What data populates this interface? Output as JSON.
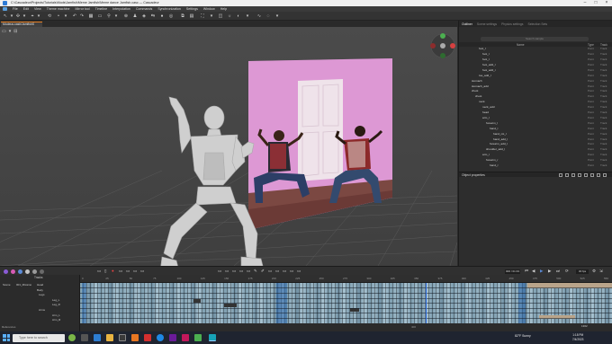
{
  "window": {
    "title": "C:\\Cascadeur\\Projects\\Tutorials\\Mods\\Jamfish\\Meme Jamfish\\Meme dance Jamfish.casc — Cascadeur"
  },
  "menu": [
    "File",
    "Edit",
    "View",
    "Theme machine",
    "Mirror tool",
    "Timeline",
    "Interpolation",
    "Commands",
    "Synchronization",
    "Settings",
    "Window",
    "Help"
  ],
  "document": {
    "tab_label": "Modeus.cash/JamfishS"
  },
  "outliner": {
    "tabs": [
      "Outliner",
      "Scene settings",
      "Physics settings",
      "Selection Sets"
    ],
    "search_placeholder": "Search sample",
    "columns": {
      "name": "Name",
      "type": "Type",
      "track": "Track"
    },
    "rows": [
      {
        "name": "foot_l",
        "type": "Point",
        "track": "Track",
        "indent": 3
      },
      {
        "name": "foot_r",
        "type": "Point",
        "track": "Track",
        "indent": 4
      },
      {
        "name": "foot_r",
        "type": "Point",
        "track": "Track",
        "indent": 4
      },
      {
        "name": "foot_add_l",
        "type": "Point",
        "track": "Track",
        "indent": 4
      },
      {
        "name": "foot_add_r",
        "type": "Point",
        "track": "Track",
        "indent": 4
      },
      {
        "name": "toe_add_l",
        "type": "Point",
        "track": "Track",
        "indent": 3
      },
      {
        "name": "stomach",
        "type": "Point",
        "track": "Track",
        "indent": 1
      },
      {
        "name": "stomach_add",
        "type": "Point",
        "track": "Track",
        "indent": 1
      },
      {
        "name": "chest",
        "type": "Point",
        "track": "Track",
        "indent": 1
      },
      {
        "name": "chest",
        "type": "Point",
        "track": "Track",
        "indent": 2
      },
      {
        "name": "neck",
        "type": "Point",
        "track": "Track",
        "indent": 3
      },
      {
        "name": "neck_add",
        "type": "Point",
        "track": "Track",
        "indent": 4
      },
      {
        "name": "head",
        "type": "Point",
        "track": "Track",
        "indent": 4
      },
      {
        "name": "arm_l",
        "type": "Point",
        "track": "Track",
        "indent": 4
      },
      {
        "name": "forearm_l",
        "type": "Point",
        "track": "Track",
        "indent": 5
      },
      {
        "name": "hand_l",
        "type": "Point",
        "track": "Track",
        "indent": 6
      },
      {
        "name": "hand_rot_l",
        "type": "Point",
        "track": "Track",
        "indent": 7
      },
      {
        "name": "hand_add_l",
        "type": "Point",
        "track": "Track",
        "indent": 7
      },
      {
        "name": "forearm_add_l",
        "type": "Point",
        "track": "Track",
        "indent": 6
      },
      {
        "name": "shoulder_add_l",
        "type": "Point",
        "track": "Track",
        "indent": 5
      },
      {
        "name": "arm_r",
        "type": "Point",
        "track": "Track",
        "indent": 4
      },
      {
        "name": "forearm_r",
        "type": "Point",
        "track": "Track",
        "indent": 5
      },
      {
        "name": "hand_r",
        "type": "Point",
        "track": "Track",
        "indent": 6
      }
    ],
    "object_properties_label": "Object properties"
  },
  "transport": {
    "frame": "000 / 01:33",
    "fps": "30 fps"
  },
  "timeline": {
    "tracks_header": "Tracks",
    "track_items": [
      {
        "label": "Scene",
        "x": 3,
        "row": 0
      },
      {
        "label": "001_Mixamo",
        "x": 18,
        "row": 0
      },
      {
        "label": "Head",
        "x": 41,
        "row": 0
      },
      {
        "label": "Body",
        "x": 41,
        "row": 1
      },
      {
        "label": "Legs",
        "x": 43,
        "row": 2
      },
      {
        "label": "Leg_L",
        "x": 58,
        "row": 3
      },
      {
        "label": "Leg_R",
        "x": 58,
        "row": 4
      },
      {
        "label": "Arms",
        "x": 43,
        "row": 5
      },
      {
        "label": "Arm_L",
        "x": 58,
        "row": 6
      },
      {
        "label": "Arm_R",
        "x": 58,
        "row": 7
      }
    ],
    "ruler_ticks": [
      "0",
      "25",
      "50",
      "75",
      "100",
      "125",
      "150",
      "175",
      "200",
      "225",
      "250",
      "275",
      "300",
      "325",
      "350",
      "375",
      "400",
      "425",
      "450",
      "475",
      "500",
      "525",
      "550"
    ],
    "references_label": "References",
    "bottom_value": "400",
    "zoom_value": "1362"
  },
  "taskbar": {
    "search_placeholder": "Type here to search",
    "weather": "82°F Sunny",
    "time": "1:18 PM",
    "date": "7/4/2023"
  }
}
